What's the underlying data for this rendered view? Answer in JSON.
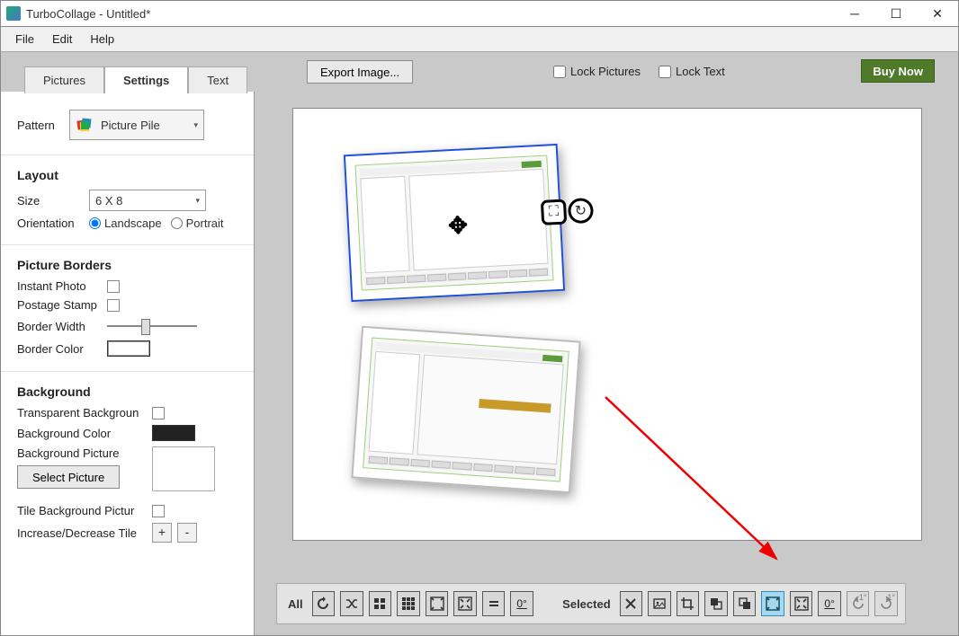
{
  "window": {
    "title": "TurboCollage - Untitled*"
  },
  "menu": {
    "file": "File",
    "edit": "Edit",
    "help": "Help"
  },
  "tabs": {
    "pictures": "Pictures",
    "settings": "Settings",
    "text": "Text",
    "active": "settings"
  },
  "toolbar": {
    "export": "Export Image...",
    "lock_pictures": "Lock Pictures",
    "lock_text": "Lock Text",
    "buy_now": "Buy Now"
  },
  "settings": {
    "pattern_label": "Pattern",
    "pattern_value": "Picture Pile",
    "layout_hdr": "Layout",
    "size_label": "Size",
    "size_value": "6 X 8",
    "orientation_label": "Orientation",
    "orientation_landscape": "Landscape",
    "orientation_portrait": "Portrait",
    "orientation_value": "Landscape",
    "borders_hdr": "Picture Borders",
    "instant_photo": "Instant Photo",
    "postage_stamp": "Postage Stamp",
    "border_width": "Border Width",
    "border_color": "Border Color",
    "bg_hdr": "Background",
    "transparent_bg": "Transparent Backgroun",
    "bg_color": "Background Color",
    "bg_picture": "Background Picture",
    "select_picture": "Select Picture",
    "tile_bg": "Tile Background Pictur",
    "inc_dec_tile": "Increase/Decrease Tile",
    "plus": "+",
    "minus": "-"
  },
  "bottombar": {
    "all_label": "All",
    "selected_label": "Selected",
    "all_buttons": [
      "rotate-icon",
      "shuffle-icon",
      "grid4-icon",
      "grid9-icon",
      "fit-icon",
      "fill-icon",
      "equals-icon",
      "zero-deg-icon"
    ],
    "sel_buttons": [
      "close-icon",
      "image-icon",
      "crop-icon",
      "send-back-icon",
      "bring-front-icon",
      "fit-sel-icon",
      "fill-sel-icon",
      "zero-deg-sel-icon",
      "rotate-ccw-icon",
      "rotate-cw-icon"
    ],
    "highlighted": "fit-sel-icon",
    "zero_label": "0°",
    "one_label": "1°"
  }
}
